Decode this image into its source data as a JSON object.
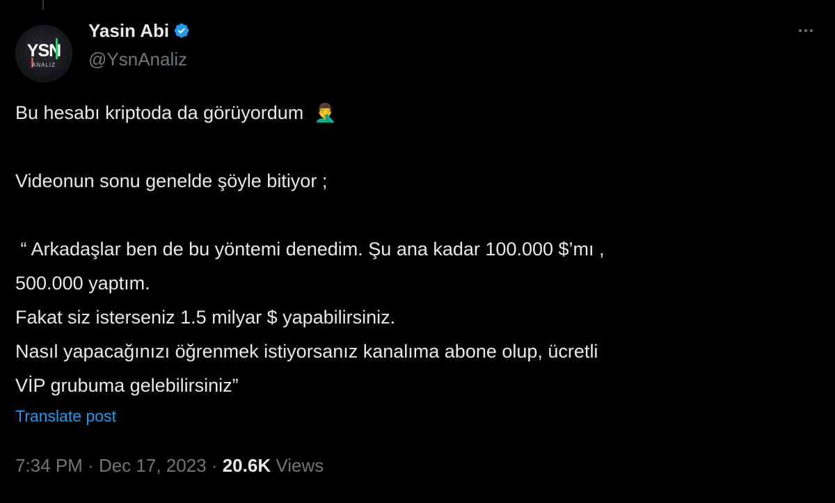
{
  "author": {
    "display_name": "Yasin Abi",
    "handle": "@YsnAnaliz",
    "verified": true,
    "avatar_text": "YSN",
    "avatar_subtext": "ANALIZ"
  },
  "tweet": {
    "lines": [
      "Bu hesabı kriptoda da görüyordum",
      "",
      "Videonun sonu genelde şöyle bitiyor ;",
      "",
      " “ Arkadaşlar ben de bu yöntemi denedim. Şu ana kadar 100.000 $’mı ,",
      "500.000 yaptım.",
      "Fakat siz isterseniz 1.5 milyar $ yapabilirsiniz.",
      "Nasıl yapacağınızı öğrenmek istiyorsanız kanalıma abone olup, ücretli",
      "VİP grubuma gelebilirsiniz”"
    ],
    "emoji": "🤦‍♂️",
    "translate_label": "Translate post"
  },
  "meta": {
    "time": "7:34 PM",
    "separator": " · ",
    "date": "Dec 17, 2023",
    "views_count": "20.6K",
    "views_label": " Views"
  },
  "colors": {
    "background": "#000000",
    "text": "#e7e9ea",
    "muted": "#71767b",
    "link": "#1d9bf0",
    "verified": "#1d9bf0"
  },
  "icons": {
    "verified": "verified-badge-icon",
    "more": "more-options-icon",
    "emoji": "facepalm-emoji"
  }
}
